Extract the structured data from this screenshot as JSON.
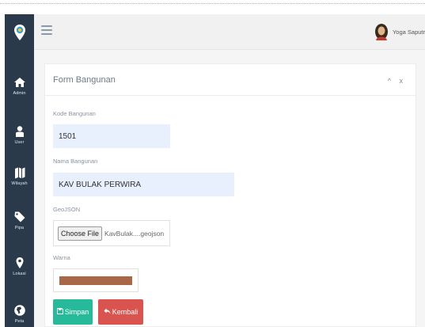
{
  "sidebar": {
    "items": [
      {
        "label": "Admin",
        "icon": "home-icon"
      },
      {
        "label": "User",
        "icon": "user-icon"
      },
      {
        "label": "Wilayah",
        "icon": "map-icon"
      },
      {
        "label": "Pipa",
        "icon": "pipe-icon"
      },
      {
        "label": "Lokasi",
        "icon": "map-marker-icon"
      },
      {
        "label": "Peta",
        "icon": "globe-icon"
      }
    ]
  },
  "header": {
    "user_name": "Yoga Saputr"
  },
  "form": {
    "title": "Form Bangunan",
    "tools": {
      "collapse": "^",
      "close": "x"
    },
    "kode_label": "Kode Bangunan",
    "kode_value": "1501",
    "nama_label": "Nama Bangunan",
    "nama_value": "KAV BULAK PERWIRA",
    "geojson_label": "GeoJSON",
    "file_button": "Choose File",
    "file_name": "KavBulak....geojson",
    "warna_label": "Warna",
    "warna_value": "#a86848",
    "save_label": "Simpan",
    "back_label": "Kembali"
  },
  "colors": {
    "sidebar": "#2b3a4a",
    "save": "#26b99a",
    "back": "#d9534f",
    "input_fill": "#e8f0fe"
  }
}
